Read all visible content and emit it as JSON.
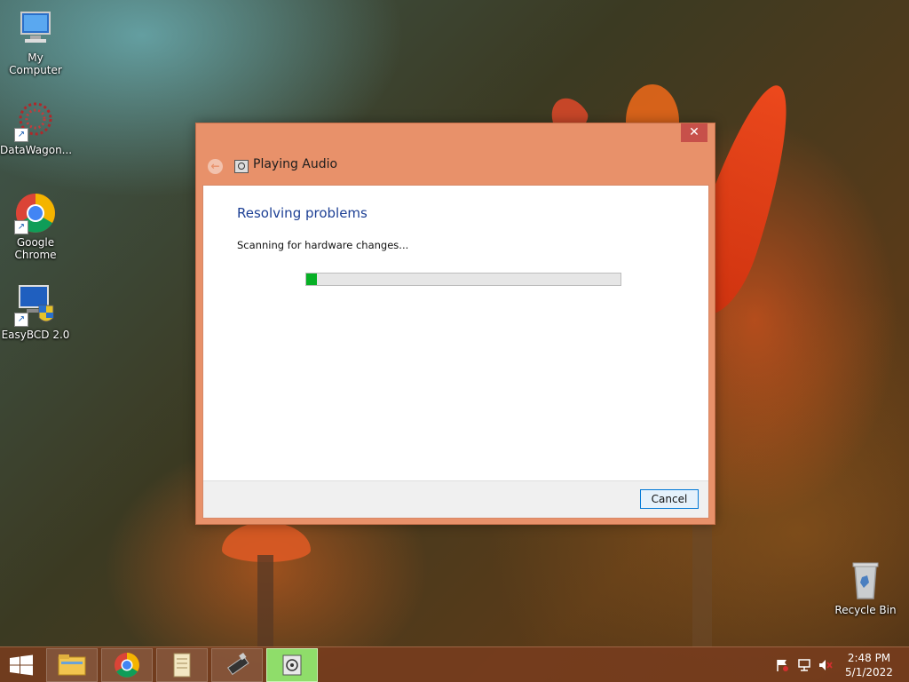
{
  "desktop": {
    "icons": [
      {
        "label": "My Computer",
        "icon": "computer-icon"
      },
      {
        "label": "DataWagon...",
        "icon": "datawagon-icon"
      },
      {
        "label": "Google Chrome",
        "icon": "chrome-icon"
      },
      {
        "label": "EasyBCD 2.0",
        "icon": "easybcd-icon"
      },
      {
        "label": "Recycle Bin",
        "icon": "recycle-bin-icon"
      }
    ]
  },
  "dialog": {
    "title": "Playing Audio",
    "close_glyph": "✕",
    "back_glyph": "←",
    "heading": "Resolving problems",
    "status": "Scanning for hardware changes...",
    "progress_fraction": 0.035,
    "cancel_label": "Cancel",
    "accent_color": "#e8916a",
    "progress_color": "#06b025"
  },
  "taskbar": {
    "start_icon": "windows-logo-icon",
    "buttons": [
      {
        "icon": "file-explorer-icon",
        "active": false
      },
      {
        "icon": "chrome-icon",
        "active": false
      },
      {
        "icon": "scroll-notepad-icon",
        "active": false
      },
      {
        "icon": "usb-drive-icon",
        "active": false
      },
      {
        "icon": "troubleshooter-icon",
        "active": true
      }
    ],
    "tray": [
      {
        "icon": "action-center-flag-icon"
      },
      {
        "icon": "network-icon"
      },
      {
        "icon": "speaker-muted-icon"
      }
    ],
    "clock": {
      "time": "2:48 PM",
      "date": "5/1/2022"
    }
  }
}
